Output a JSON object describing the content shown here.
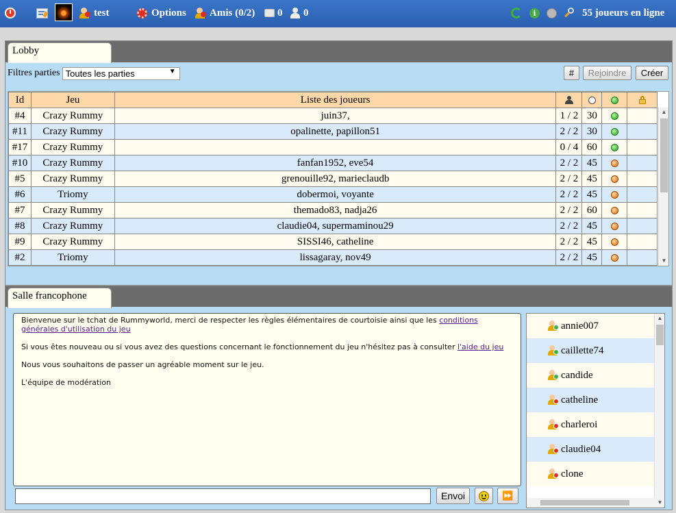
{
  "topbar": {
    "username": "test",
    "options_label": "Options",
    "friends_label": "Amis (0/2)",
    "messages_count": "0",
    "requests_count": "0",
    "online_label": "55 joueurs en ligne"
  },
  "lobby": {
    "tab_label": "Lobby",
    "filter_label": "Filtres parties",
    "filter_value": "Toutes les parties",
    "hash_button": "#",
    "join_button": "Rejoindre",
    "create_button": "Créer",
    "columns": {
      "id": "Id",
      "game": "Jeu",
      "players": "Liste des joueurs"
    },
    "rows": [
      {
        "id": "#4",
        "game": "Crazy Rummy",
        "players": "juin37,",
        "count": "1 / 2",
        "time": "30",
        "status": "green"
      },
      {
        "id": "#11",
        "game": "Crazy Rummy",
        "players": "opalinette, papillon51",
        "count": "2 / 2",
        "time": "30",
        "status": "green"
      },
      {
        "id": "#17",
        "game": "Crazy Rummy",
        "players": "",
        "count": "0 / 4",
        "time": "60",
        "status": "green"
      },
      {
        "id": "#10",
        "game": "Crazy Rummy",
        "players": "fanfan1952, eve54",
        "count": "2 / 2",
        "time": "45",
        "status": "orange"
      },
      {
        "id": "#5",
        "game": "Crazy Rummy",
        "players": "grenouille92, marieclaudb",
        "count": "2 / 2",
        "time": "45",
        "status": "orange"
      },
      {
        "id": "#6",
        "game": "Triomy",
        "players": "dobermoi, voyante",
        "count": "2 / 2",
        "time": "45",
        "status": "orange"
      },
      {
        "id": "#7",
        "game": "Crazy Rummy",
        "players": "themado83, nadja26",
        "count": "2 / 2",
        "time": "60",
        "status": "orange"
      },
      {
        "id": "#8",
        "game": "Crazy Rummy",
        "players": "claudie04, supermaminou29",
        "count": "2 / 2",
        "time": "45",
        "status": "orange"
      },
      {
        "id": "#9",
        "game": "Crazy Rummy",
        "players": "SISSI46, catheline",
        "count": "2 / 2",
        "time": "45",
        "status": "orange"
      },
      {
        "id": "#2",
        "game": "Triomy",
        "players": "lissagaray, nov49",
        "count": "2 / 2",
        "time": "45",
        "status": "orange"
      }
    ]
  },
  "chat": {
    "tab_label": "Salle francophone",
    "msg1_pre": "Bienvenue sur le tchat de Rummyworld, merci de respecter les règles élémentaires de courtoisie ainsi que les ",
    "msg1_link": "conditions générales d'utilisation du jeu",
    "msg2_pre": "Si vous êtes nouveau ou si vous avez des questions concernant le fonctionnement du jeu n'hésitez pas à consulter ",
    "msg2_link": "l'aide du jeu",
    "msg3": "Nous vous souhaitons de passer un agréable moment sur le jeu.",
    "msg4": "L'équipe de modération",
    "send_button": "Envoi",
    "users": [
      {
        "name": "annie007",
        "state": "green"
      },
      {
        "name": "caillette74",
        "state": "green"
      },
      {
        "name": "candide",
        "state": "green"
      },
      {
        "name": "catheline",
        "state": "red"
      },
      {
        "name": "charleroi",
        "state": "red"
      },
      {
        "name": "claudie04",
        "state": "red"
      },
      {
        "name": "clone",
        "state": "red"
      }
    ]
  },
  "colors": {
    "topbar": "#2f65b5",
    "header_row": "#fed8a8",
    "row_even": "#d9ebfa",
    "row_odd": "#fffbee",
    "frame_bg": "#b9dcf5",
    "tabbar": "#6c6c6c"
  },
  "icons": [
    "power-icon",
    "edit-icon",
    "avatar-image",
    "user-icon",
    "gear-icon",
    "friends-icon",
    "message-icon",
    "user-request-icon",
    "refresh-icon",
    "info-icon",
    "sound-icon",
    "search-icon",
    "players-icon",
    "clock-icon",
    "status-icon",
    "lock-icon",
    "smiley-icon",
    "forward-icon"
  ]
}
